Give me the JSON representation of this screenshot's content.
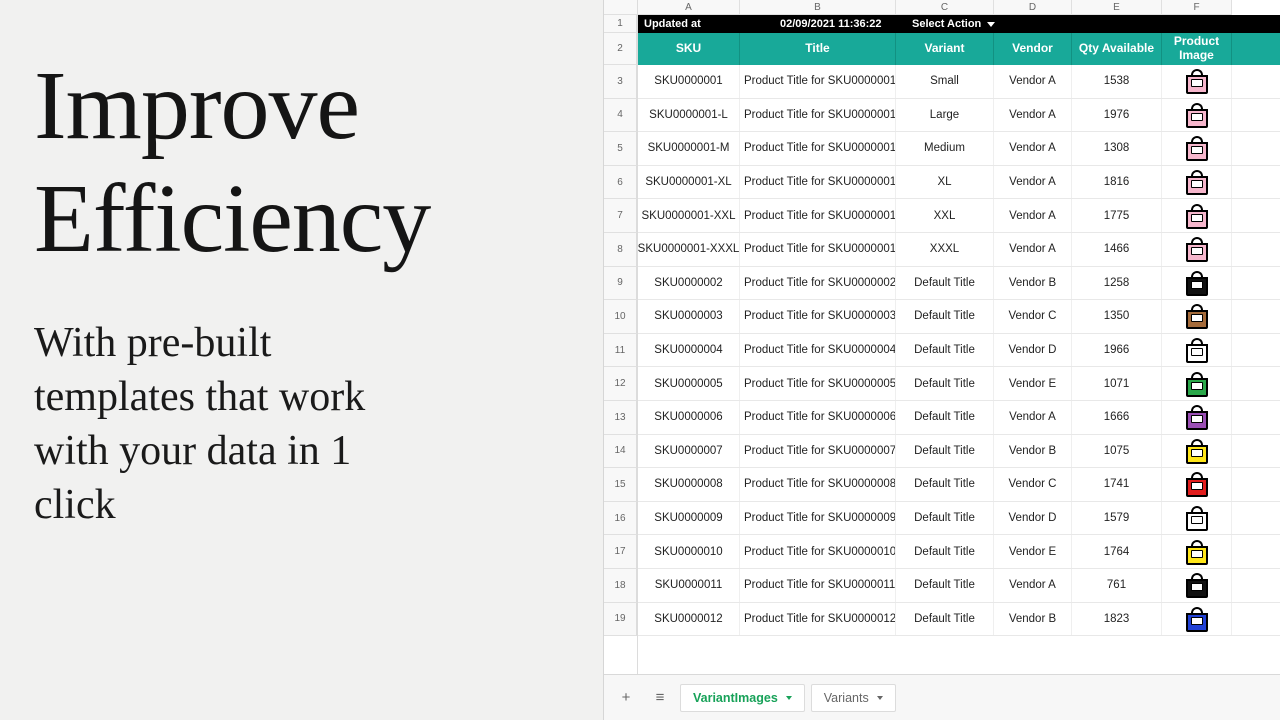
{
  "marketing": {
    "headline_l1": "Improve",
    "headline_l2": "Efficiency",
    "subtext": "With pre-built templates that work with your data in 1 click"
  },
  "spreadsheet": {
    "col_letters": [
      "A",
      "B",
      "C",
      "D",
      "E",
      "F"
    ],
    "top_bar": {
      "updated_label": "Updated at",
      "timestamp": "02/09/2021 11:36:22",
      "action_label": "Select Action"
    },
    "headers": {
      "sku": "SKU",
      "title": "Title",
      "variant": "Variant",
      "vendor": "Vendor",
      "qty": "Qty Available",
      "image": "Product Image"
    },
    "rows": [
      {
        "n": 3,
        "sku": "SKU0000001",
        "title": "Product Title for SKU0000001",
        "variant": "Small",
        "vendor": "Vendor A",
        "qty": "1538",
        "color": "#f6b6cc"
      },
      {
        "n": 4,
        "sku": "SKU0000001-L",
        "title": "Product Title for SKU0000001",
        "variant": "Large",
        "vendor": "Vendor A",
        "qty": "1976",
        "color": "#f6b6cc"
      },
      {
        "n": 5,
        "sku": "SKU0000001-M",
        "title": "Product Title for SKU0000001",
        "variant": "Medium",
        "vendor": "Vendor A",
        "qty": "1308",
        "color": "#f6b6cc"
      },
      {
        "n": 6,
        "sku": "SKU0000001-XL",
        "title": "Product Title for SKU0000001",
        "variant": "XL",
        "vendor": "Vendor A",
        "qty": "1816",
        "color": "#f6b6cc"
      },
      {
        "n": 7,
        "sku": "SKU0000001-XXL",
        "title": "Product Title for SKU0000001",
        "variant": "XXL",
        "vendor": "Vendor A",
        "qty": "1775",
        "color": "#f6b6cc"
      },
      {
        "n": 8,
        "sku": "SKU0000001-XXXL",
        "title": "Product Title for SKU0000001",
        "variant": "XXXL",
        "vendor": "Vendor A",
        "qty": "1466",
        "color": "#f6b6cc"
      },
      {
        "n": 9,
        "sku": "SKU0000002",
        "title": "Product Title for SKU0000002",
        "variant": "Default Title",
        "vendor": "Vendor B",
        "qty": "1258",
        "color": "#111111"
      },
      {
        "n": 10,
        "sku": "SKU0000003",
        "title": "Product Title for SKU0000003",
        "variant": "Default Title",
        "vendor": "Vendor C",
        "qty": "1350",
        "color": "#a56b3a"
      },
      {
        "n": 11,
        "sku": "SKU0000004",
        "title": "Product Title for SKU0000004",
        "variant": "Default Title",
        "vendor": "Vendor D",
        "qty": "1966",
        "color": "#ffffff"
      },
      {
        "n": 12,
        "sku": "SKU0000005",
        "title": "Product Title for SKU0000005",
        "variant": "Default Title",
        "vendor": "Vendor E",
        "qty": "1071",
        "color": "#2aa84a"
      },
      {
        "n": 13,
        "sku": "SKU0000006",
        "title": "Product Title for SKU0000006",
        "variant": "Default Title",
        "vendor": "Vendor A",
        "qty": "1666",
        "color": "#9b4fb5"
      },
      {
        "n": 14,
        "sku": "SKU0000007",
        "title": "Product Title for SKU0000007",
        "variant": "Default Title",
        "vendor": "Vendor B",
        "qty": "1075",
        "color": "#ffe619"
      },
      {
        "n": 15,
        "sku": "SKU0000008",
        "title": "Product Title for SKU0000008",
        "variant": "Default Title",
        "vendor": "Vendor C",
        "qty": "1741",
        "color": "#e21e1e"
      },
      {
        "n": 16,
        "sku": "SKU0000009",
        "title": "Product Title for SKU0000009",
        "variant": "Default Title",
        "vendor": "Vendor D",
        "qty": "1579",
        "color": "#ffffff"
      },
      {
        "n": 17,
        "sku": "SKU0000010",
        "title": "Product Title for SKU0000010",
        "variant": "Default Title",
        "vendor": "Vendor E",
        "qty": "1764",
        "color": "#ffe619"
      },
      {
        "n": 18,
        "sku": "SKU0000011",
        "title": "Product Title for SKU0000011",
        "variant": "Default Title",
        "vendor": "Vendor A",
        "qty": "761",
        "color": "#111111"
      },
      {
        "n": 19,
        "sku": "SKU0000012",
        "title": "Product Title for SKU0000012",
        "variant": "Default Title",
        "vendor": "Vendor B",
        "qty": "1823",
        "color": "#2141d6"
      }
    ],
    "tabs": {
      "active": "VariantImages",
      "inactive": "Variants"
    }
  }
}
